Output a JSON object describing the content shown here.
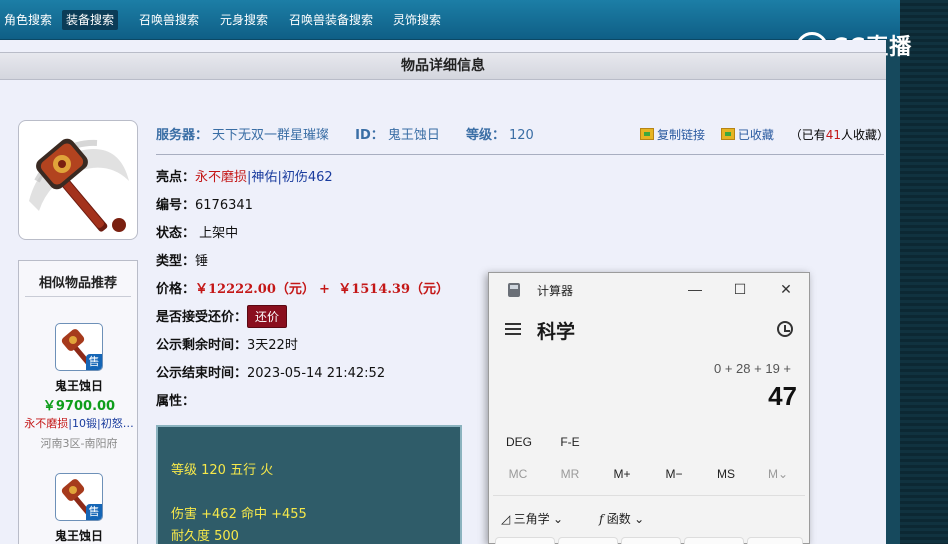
{
  "nav": {
    "items": [
      {
        "label": "角色搜索",
        "active": false
      },
      {
        "label": "装备搜索",
        "active": true
      },
      {
        "label": "召唤兽搜索",
        "active": false
      },
      {
        "label": "元身搜索",
        "active": false
      },
      {
        "label": "召唤兽装备搜索",
        "active": false
      },
      {
        "label": "灵饰搜索",
        "active": false
      }
    ]
  },
  "logo": {
    "text": "CC直播"
  },
  "page": {
    "header_title": "物品详细信息",
    "server_label": "服务器：",
    "server_value": "天下无双一群星璀璨",
    "id_label": "ID：",
    "id_value": "鬼王蚀日",
    "level_label": "等级：",
    "level_value": "120",
    "copy_link": "复制链接",
    "collected": "已收藏",
    "collect_prefix": "（已有",
    "collect_count": "41",
    "collect_suffix": "人收藏）",
    "highlight_label": "亮点：",
    "highlight_1": "永不磨损",
    "highlight_sep1": "|",
    "highlight_2": "神佑",
    "highlight_sep2": "|",
    "highlight_3": "初伤462",
    "code_label": "编号：",
    "code_value": "6176341",
    "status_label": "状态：",
    "status_value": "上架中",
    "type_label": "类型：",
    "type_value": "锤",
    "price_label": "价格：",
    "price_1": "￥12222.00（元）",
    "price_plus": "+",
    "price_2": "￥1514.39（元）",
    "counter_label": "是否接受还价：",
    "counter_button": "还价",
    "remaining_label": "公示剩余时间：",
    "remaining_value": "3天22时",
    "end_label": "公示结束时间：",
    "end_value": "2023-05-14 21:42:52",
    "attr_label": "属性：",
    "attr_lines": [
      "等级 120 五行 火",
      "伤害 +462 命中 +455",
      "耐久度 500"
    ]
  },
  "similar": {
    "title": "相似物品推荐",
    "items": [
      {
        "name": "鬼王蚀日",
        "price": "￥9700.00",
        "tag1": "永不磨损",
        "tag2": "|10锻",
        "tag3": "|初怒…",
        "server": "河南3区-南阳府",
        "sale": "售"
      },
      {
        "name": "鬼王蚀日",
        "sale": "售"
      }
    ]
  },
  "calculator": {
    "title": "计算器",
    "mode": "科学",
    "expression": "0 + 28 + 19 +",
    "result": "47",
    "deg": "DEG",
    "fe": "F-E",
    "memory": [
      "MC",
      "MR",
      "M+",
      "M−",
      "MS",
      "M⌄"
    ],
    "trig": "三角学",
    "func": "函数",
    "minimize": "—",
    "maximize": "☐",
    "close": "✕"
  }
}
